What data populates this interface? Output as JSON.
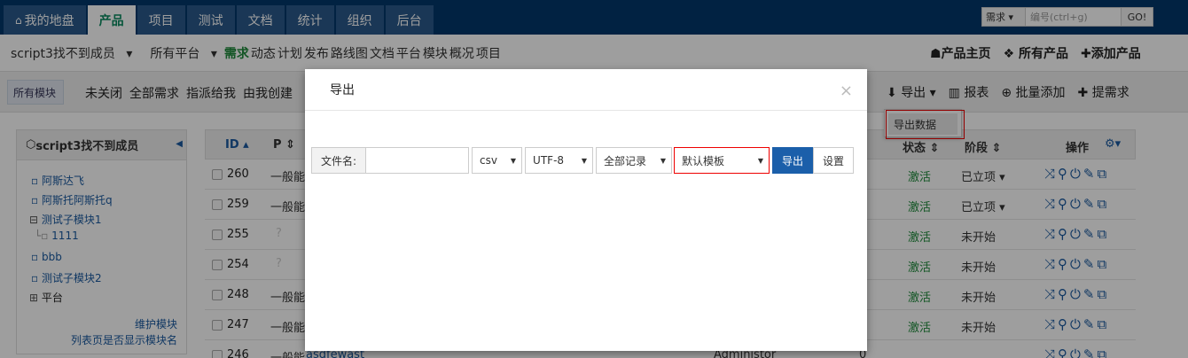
{
  "top_nav": {
    "items": [
      {
        "label": "我的地盘",
        "icon": "home-icon"
      },
      {
        "label": "产品",
        "active": true
      },
      {
        "label": "项目"
      },
      {
        "label": "测试"
      },
      {
        "label": "文档"
      },
      {
        "label": "统计"
      },
      {
        "label": "组织"
      },
      {
        "label": "后台"
      }
    ]
  },
  "search": {
    "type": "需求",
    "placeholder": "编号(ctrl+g)",
    "go": "GO!"
  },
  "sub_nav": {
    "product": "script3找不到成员",
    "platform": "所有平台",
    "items": [
      "需求",
      "动态",
      "计划",
      "发布",
      "路线图",
      "文档",
      "平台",
      "模块",
      "概况",
      "项目"
    ]
  },
  "right_links": [
    "产品主页",
    "所有产品",
    "添加产品"
  ],
  "feature_bar": {
    "crumb": "所有模块",
    "filters": [
      "未关闭",
      "全部需求",
      "指派给我",
      "由我创建"
    ],
    "actions": [
      "导出",
      "报表",
      "批量添加",
      "提需求"
    ]
  },
  "export_menu": {
    "item": "导出数据"
  },
  "tree": {
    "title": "script3找不到成员",
    "items": [
      "阿斯达飞",
      "阿斯托阿斯托q",
      "测试子模块1",
      "1111",
      "bbb",
      "测试子模块2",
      "平台"
    ],
    "footer": [
      "维护模块",
      "列表页是否显示模块名"
    ]
  },
  "table": {
    "headers": {
      "id": "ID",
      "pri": "P",
      "status": "状态",
      "stage": "阶段",
      "actions": "操作"
    },
    "rows": [
      {
        "id": "260",
        "p": "一般能",
        "status": "激活",
        "stage": "已立项"
      },
      {
        "id": "259",
        "p": "一般能",
        "status": "激活",
        "stage": "已立项"
      },
      {
        "id": "255",
        "p": "",
        "status": "激活",
        "stage": "未开始"
      },
      {
        "id": "254",
        "p": "",
        "status": "激活",
        "stage": "未开始"
      },
      {
        "id": "248",
        "p": "一般能",
        "status": "激活",
        "stage": "未开始"
      },
      {
        "id": "247",
        "p": "一般能",
        "status": "激活",
        "stage": "未开始"
      },
      {
        "id": "246",
        "p": "一般能",
        "title": "asdfewast",
        "user": "Administor",
        "num": "0",
        "status": "",
        "stage": ""
      }
    ]
  },
  "modal": {
    "title": "导出",
    "close": "×",
    "filename_label": "文件名:",
    "filename_value": "",
    "format": "csv",
    "encoding": "UTF-8",
    "range": "全部记录",
    "template": "默认模板",
    "export_button": "导出",
    "settings_button": "设置"
  }
}
